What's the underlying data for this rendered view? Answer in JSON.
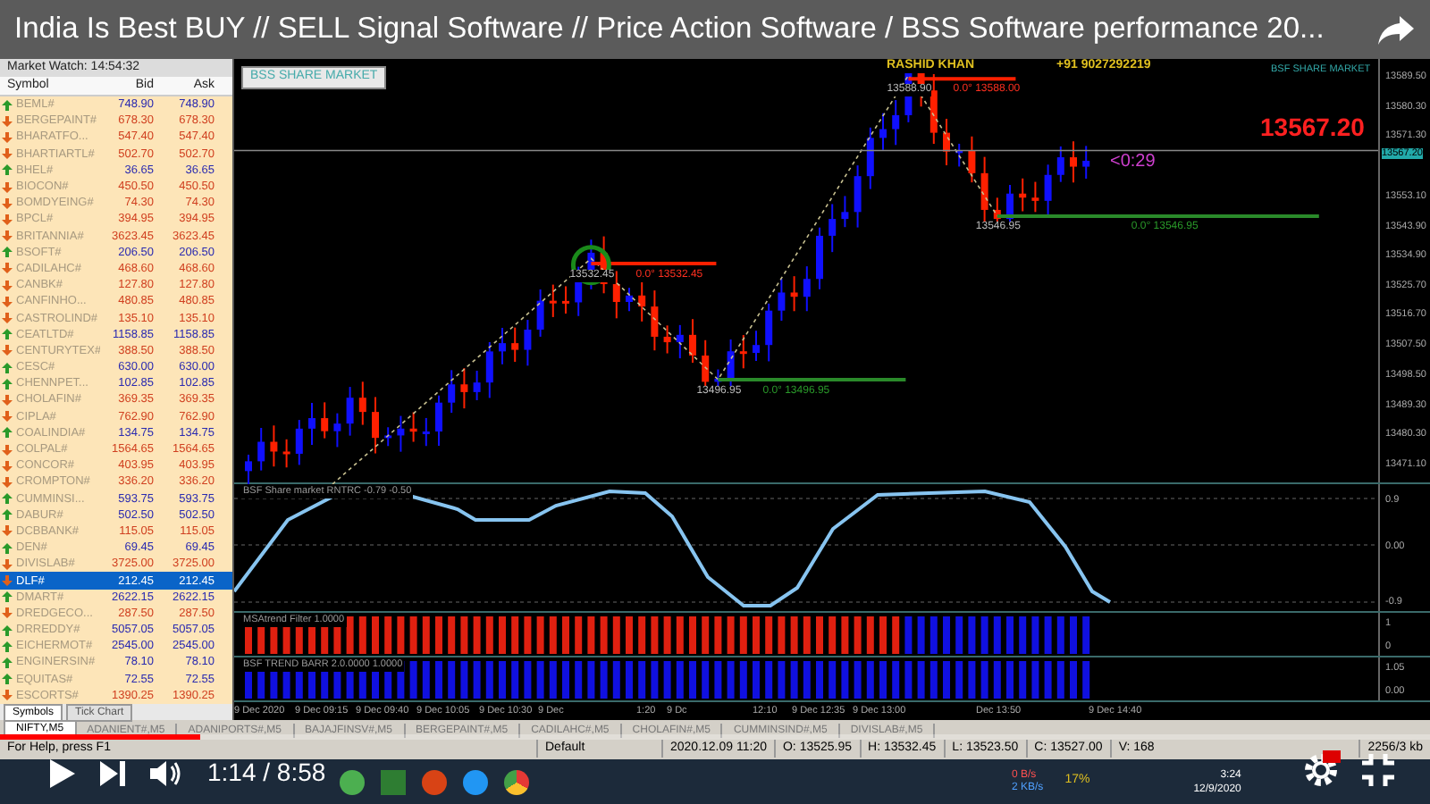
{
  "video": {
    "title": "India Is Best BUY // SELL Signal Software // Price Action Software / BSS Software performance 20...",
    "time": "1:14 / 8:58",
    "progress": {
      "level": 0.14
    }
  },
  "market_watch": {
    "title": "Market Watch: 14:54:32",
    "columns": [
      "Symbol",
      "Bid",
      "Ask"
    ],
    "rows": [
      {
        "symbol": "BEML#",
        "bid": "748.90",
        "ask": "748.90",
        "rising": true,
        "selected": false
      },
      {
        "symbol": "BERGEPAINT#",
        "bid": "678.30",
        "ask": "678.30",
        "rising": false,
        "selected": false
      },
      {
        "symbol": "BHARATFO...",
        "bid": "547.40",
        "ask": "547.40",
        "rising": false,
        "selected": false
      },
      {
        "symbol": "BHARTIARTL#",
        "bid": "502.70",
        "ask": "502.70",
        "rising": false,
        "selected": false
      },
      {
        "symbol": "BHEL#",
        "bid": "36.65",
        "ask": "36.65",
        "rising": true,
        "selected": false
      },
      {
        "symbol": "BIOCON#",
        "bid": "450.50",
        "ask": "450.50",
        "rising": false,
        "selected": false
      },
      {
        "symbol": "BOMDYEING#",
        "bid": "74.30",
        "ask": "74.30",
        "rising": false,
        "selected": false
      },
      {
        "symbol": "BPCL#",
        "bid": "394.95",
        "ask": "394.95",
        "rising": false,
        "selected": false
      },
      {
        "symbol": "BRITANNIA#",
        "bid": "3623.45",
        "ask": "3623.45",
        "rising": false,
        "selected": false
      },
      {
        "symbol": "BSOFT#",
        "bid": "206.50",
        "ask": "206.50",
        "rising": true,
        "selected": false
      },
      {
        "symbol": "CADILAHC#",
        "bid": "468.60",
        "ask": "468.60",
        "rising": false,
        "selected": false
      },
      {
        "symbol": "CANBK#",
        "bid": "127.80",
        "ask": "127.80",
        "rising": false,
        "selected": false
      },
      {
        "symbol": "CANFINHO...",
        "bid": "480.85",
        "ask": "480.85",
        "rising": false,
        "selected": false
      },
      {
        "symbol": "CASTROLIND#",
        "bid": "135.10",
        "ask": "135.10",
        "rising": false,
        "selected": false
      },
      {
        "symbol": "CEATLTD#",
        "bid": "1158.85",
        "ask": "1158.85",
        "rising": true,
        "selected": false
      },
      {
        "symbol": "CENTURYTEX#",
        "bid": "388.50",
        "ask": "388.50",
        "rising": false,
        "selected": false
      },
      {
        "symbol": "CESC#",
        "bid": "630.00",
        "ask": "630.00",
        "rising": true,
        "selected": false
      },
      {
        "symbol": "CHENNPET...",
        "bid": "102.85",
        "ask": "102.85",
        "rising": true,
        "selected": false
      },
      {
        "symbol": "CHOLAFIN#",
        "bid": "369.35",
        "ask": "369.35",
        "rising": false,
        "selected": false
      },
      {
        "symbol": "CIPLA#",
        "bid": "762.90",
        "ask": "762.90",
        "rising": false,
        "selected": false
      },
      {
        "symbol": "COALINDIA#",
        "bid": "134.75",
        "ask": "134.75",
        "rising": true,
        "selected": false
      },
      {
        "symbol": "COLPAL#",
        "bid": "1564.65",
        "ask": "1564.65",
        "rising": false,
        "selected": false
      },
      {
        "symbol": "CONCOR#",
        "bid": "403.95",
        "ask": "403.95",
        "rising": false,
        "selected": false
      },
      {
        "symbol": "CROMPTON#",
        "bid": "336.20",
        "ask": "336.20",
        "rising": false,
        "selected": false
      },
      {
        "symbol": "CUMMINSI...",
        "bid": "593.75",
        "ask": "593.75",
        "rising": true,
        "selected": false
      },
      {
        "symbol": "DABUR#",
        "bid": "502.50",
        "ask": "502.50",
        "rising": true,
        "selected": false
      },
      {
        "symbol": "DCBBANK#",
        "bid": "115.05",
        "ask": "115.05",
        "rising": false,
        "selected": false
      },
      {
        "symbol": "DEN#",
        "bid": "69.45",
        "ask": "69.45",
        "rising": true,
        "selected": false
      },
      {
        "symbol": "DIVISLAB#",
        "bid": "3725.00",
        "ask": "3725.00",
        "rising": false,
        "selected": false
      },
      {
        "symbol": "DLF#",
        "bid": "212.45",
        "ask": "212.45",
        "rising": false,
        "selected": true
      },
      {
        "symbol": "DMART#",
        "bid": "2622.15",
        "ask": "2622.15",
        "rising": true,
        "selected": false
      },
      {
        "symbol": "DREDGECO...",
        "bid": "287.50",
        "ask": "287.50",
        "rising": false,
        "selected": false
      },
      {
        "symbol": "DRREDDY#",
        "bid": "5057.05",
        "ask": "5057.05",
        "rising": true,
        "selected": false
      },
      {
        "symbol": "EICHERMOT#",
        "bid": "2545.00",
        "ask": "2545.00",
        "rising": true,
        "selected": false
      },
      {
        "symbol": "ENGINERSIN#",
        "bid": "78.10",
        "ask": "78.10",
        "rising": true,
        "selected": false
      },
      {
        "symbol": "EQUITAS#",
        "bid": "72.55",
        "ask": "72.55",
        "rising": true,
        "selected": false
      },
      {
        "symbol": "ESCORTS#",
        "bid": "1390.25",
        "ask": "1390.25",
        "rising": false,
        "selected": false
      }
    ],
    "tabs": [
      {
        "label": "Symbols",
        "selected": true
      },
      {
        "label": "Tick Chart",
        "selected": false
      }
    ]
  },
  "chart": {
    "header_box": "BSS SHARE MARKET",
    "brand": "BSF SHARE MARKET",
    "author": "RASHID KHAN",
    "phone": "+91 9027292219",
    "price_big": "13567.20",
    "countdown": "<0:29",
    "current_price": "13567.20",
    "swings": [
      {
        "kind": "high",
        "price": "13532.45",
        "fib": "0.0° 13532.45"
      },
      {
        "kind": "low",
        "price": "13496.95",
        "fib": "0.0° 13496.95"
      },
      {
        "kind": "high",
        "price": "13588.90",
        "fib": "0.0° 13588.00"
      },
      {
        "kind": "low",
        "price": "13546.95",
        "fib": "0.0° 13546.95"
      }
    ],
    "price_axis": [
      "13589.50",
      "13580.30",
      "13571.30",
      "13553.10",
      "13543.90",
      "13534.90",
      "13525.70",
      "13516.70",
      "13507.50",
      "13498.50",
      "13489.30",
      "13480.30",
      "13471.10"
    ],
    "time_axis": [
      "9 Dec 2020",
      "9 Dec 09:15",
      "9 Dec 09:40",
      "9 Dec 10:05",
      "9 Dec 10:30",
      "9 Dec",
      "1:20",
      "9 Dc",
      "12:10",
      "9 Dec 12:35",
      "9 Dec 13:00",
      "Dec 13:50",
      "9 Dec 14:40"
    ],
    "indicators": [
      {
        "kind": "line",
        "label": "BSF Share market RNTRC -0.79 -0.50",
        "axis": [
          "0.9",
          "0.00",
          "-0.9"
        ]
      },
      {
        "kind": "two_color_bars",
        "label": "MSAtrend Filter 1.0000",
        "axis": [
          "1",
          "0"
        ]
      },
      {
        "kind": "bars",
        "label": "BSF TREND BARR 2.0.0000 1.0000",
        "axis": [
          "1.05",
          "0.00"
        ]
      }
    ]
  },
  "symbol_tabs": [
    {
      "label": "NIFTY,M5",
      "selected": true
    },
    {
      "label": "ADANIENT#,M5",
      "selected": false
    },
    {
      "label": "ADANIPORTS#,M5",
      "selected": false
    },
    {
      "label": "BAJAJFINSV#,M5",
      "selected": false
    },
    {
      "label": "BERGEPAINT#,M5",
      "selected": false
    },
    {
      "label": "CADILAHC#,M5",
      "selected": false
    },
    {
      "label": "CHOLAFIN#,M5",
      "selected": false
    },
    {
      "label": "CUMMINSIND#,M5",
      "selected": false
    },
    {
      "label": "DIVISLAB#,M5",
      "selected": false
    }
  ],
  "status_bar": {
    "help": "For Help, press F1",
    "profile": "Default",
    "datetime": "2020.12.09 11:20",
    "open": "O: 13525.95",
    "high": "H: 13532.45",
    "low": "L: 13523.50",
    "close": "C: 13527.00",
    "volume": "V: 168",
    "traffic": "2256/3 kb"
  },
  "taskbar": {
    "net_down": "0 B/s",
    "net_up": "2 KB/s",
    "battery": "17%",
    "time": "3:24",
    "date": "12/9/2020"
  }
}
